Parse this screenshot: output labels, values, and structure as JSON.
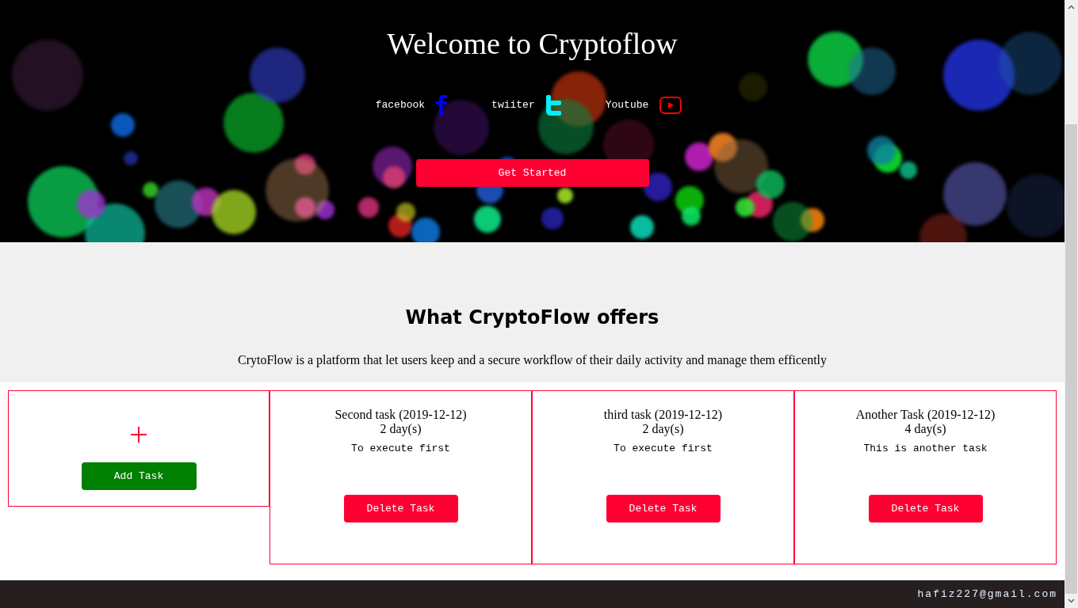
{
  "hero": {
    "title": "Welcome to Cryptoflow",
    "social_links": [
      {
        "label": "facebook",
        "kind": "facebook"
      },
      {
        "label": "twiiter",
        "kind": "twitter"
      },
      {
        "label": "Youtube",
        "kind": "youtube"
      }
    ],
    "button": "Get Started"
  },
  "offers": {
    "heading": "What CryptoFlow offers",
    "description": "CrytoFlow is a platform that let users keep and a secure workflow of their daily activity and manage them efficently"
  },
  "add_card": {
    "button": "Add Task"
  },
  "tasks": [
    {
      "title": "Second task (2019-12-12)",
      "duration": "2 day(s)",
      "description": "To execute first",
      "button": "Delete Task"
    },
    {
      "title": "third task (2019-12-12)",
      "duration": "2 day(s)",
      "description": "To execute first",
      "button": "Delete Task"
    },
    {
      "title": "Another Task (2019-12-12)",
      "duration": "4 day(s)",
      "description": "This is another task",
      "button": "Delete Task"
    }
  ],
  "footer": {
    "email": "hafiz227@gmail.com"
  }
}
